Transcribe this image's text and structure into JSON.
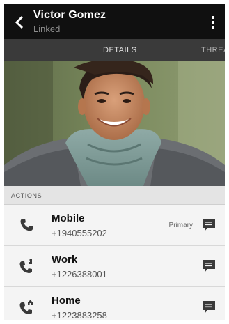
{
  "header": {
    "contact_name": "Victor Gomez",
    "status": "Linked",
    "back_icon": "back-arrow-icon",
    "menu_icon": "overflow-menu-icon"
  },
  "tabs": [
    {
      "label": "DETAILS",
      "selected": true
    },
    {
      "label": "THREA",
      "selected": false
    }
  ],
  "photo": {
    "description_icon": "contact-photo"
  },
  "actions": {
    "section_label": "ACTIONS",
    "items": [
      {
        "label": "Mobile",
        "number": "+1940555202",
        "badge": "Primary",
        "icon": "mobile-phone-icon"
      },
      {
        "label": "Work",
        "number": "+1226388001",
        "badge": "",
        "icon": "work-phone-icon"
      },
      {
        "label": "Home",
        "number": "+1223883258",
        "badge": "",
        "icon": "home-phone-icon"
      }
    ]
  },
  "colors": {
    "appbar": "#101010",
    "tabbar": "#3a3a3a",
    "row_bg": "#f4f4f4",
    "icon": "#3a3a3a"
  }
}
